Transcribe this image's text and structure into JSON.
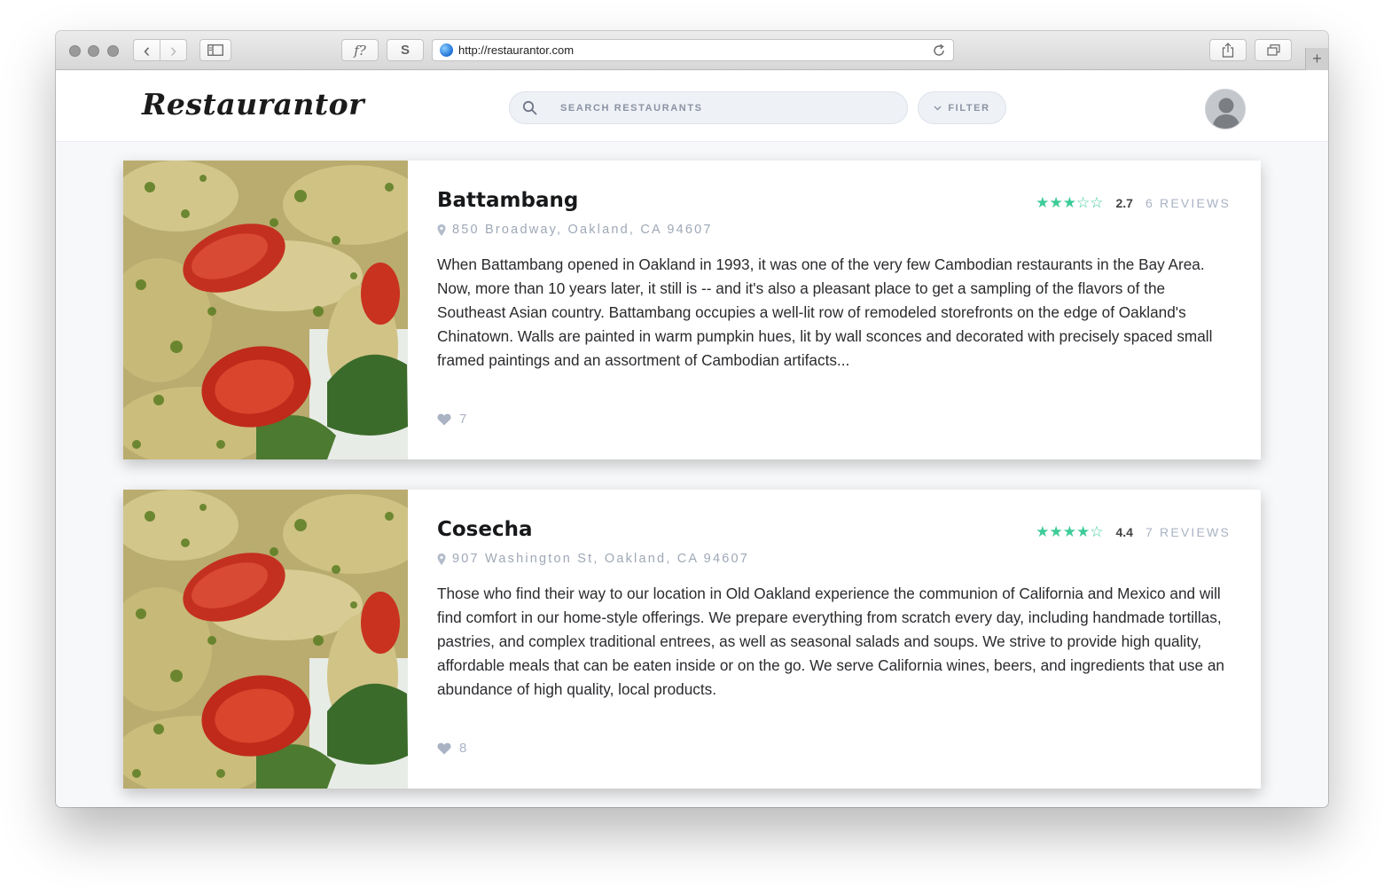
{
  "browser": {
    "url": "http://restaurantor.com",
    "toolbar_buttons": {
      "back": "‹",
      "forward": "›",
      "fx_label": "f?",
      "s_label": "S",
      "new_tab": "+"
    }
  },
  "header": {
    "logo": "Restaurantor",
    "search": {
      "placeholder": "SEARCH RESTAURANTS",
      "value": ""
    },
    "filter_label": "FILTER"
  },
  "restaurants": [
    {
      "name": "Battambang",
      "stars_display": "★★★☆☆",
      "rating": "2.7",
      "reviews": "6 REVIEWS",
      "address": "850 Broadway, Oakland, CA 94607",
      "description": "When Battambang opened in Oakland in 1993, it was one of the very few Cambodian restaurants in the Bay Area. Now, more than 10 years later, it still is -- and it's also a pleasant place to get a sampling of the flavors of the Southeast Asian country. Battambang occupies a well-lit row of remodeled storefronts on the edge of Oakland's Chinatown. Walls are painted in warm pumpkin hues, lit by wall sconces and decorated with precisely spaced small framed paintings and an assortment of Cambodian artifacts...",
      "likes": "7"
    },
    {
      "name": "Cosecha",
      "stars_display": "★★★★☆",
      "rating": "4.4",
      "reviews": "7 REVIEWS",
      "address": "907 Washington St, Oakland, CA 94607",
      "description": "Those who find their way to our location in Old Oakland experience the communion of California and Mexico and will find comfort in our home-style offerings. We prepare everything from scratch every day, including handmade tortillas, pastries, and complex traditional entrees, as well as seasonal salads and soups. We strive to provide high quality, affordable meals that can be eaten inside or on the go. We serve California wines, beers, and ingredients that use an abundance of high quality, local products.",
      "likes": "8"
    }
  ],
  "colors": {
    "accent_green": "#3dcc98",
    "muted_text": "#a9b3c4",
    "page_bg": "#f7f8fa"
  },
  "icons": [
    "globe-icon",
    "reload-icon",
    "sidebar-icon",
    "share-icon",
    "tabs-icon",
    "search-icon",
    "chevron-down-icon",
    "avatar-icon",
    "pin-icon",
    "heart-icon",
    "star-icon"
  ]
}
